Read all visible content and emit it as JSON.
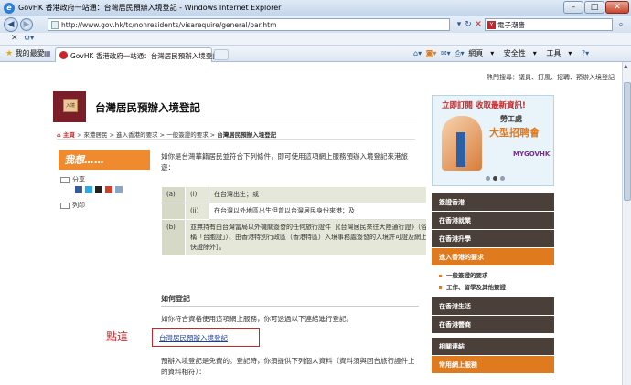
{
  "window": {
    "title": "GovHK 香港政府一站通：台灣居民預辦入境登記 - Windows Internet Explorer"
  },
  "browser": {
    "url": "http://www.gov.hk/tc/nonresidents/visarequire/general/par.htm",
    "search_value": "電子潮嗇",
    "favorites_label": "我的最愛",
    "tab_title": "GovHK 香港政府一站通：台灣居民預辦入境登記",
    "commands": [
      "網頁",
      "安全性",
      "工具"
    ]
  },
  "page": {
    "hotlinks": "熱門搜尋：議員、打風、招聘、預辦入境登記",
    "title": "台灣居民預辦入境登記",
    "stamp_label": "入境",
    "breadcrumb": {
      "home": "主頁",
      "items": [
        "來港居民",
        "進入香港的要求",
        "一般簽證的要求"
      ],
      "current": "台灣居民預辦入境登記"
    },
    "tools": {
      "title": "我想……",
      "share": "分享",
      "print": "列印"
    },
    "intro": "如你是台灣華籍居民並符合下列條件，即可使用這項網上服務預辦入境登記來港旅遊：",
    "conditions": [
      {
        "label": "(a)",
        "sub": "(i)",
        "text": "在台灣出生；或"
      },
      {
        "label": "",
        "sub": "(ii)",
        "text": "在台灣以外地區出生但曾以台灣居民身份來港；及"
      },
      {
        "label": "(b)",
        "sub": "",
        "text": "並無持有由台灣當局以外機關簽發的任何旅行證件［《台灣居民來往大陸通行證》（俗稱「台胞證」）、由香港特別行政區（香港特區）入境事務處簽發的入境許可證及網上快證除外］。"
      }
    ],
    "how_title": "如何登記",
    "how_text": "如你符合資格使用這項網上服務，你可透過以下連結進行登記。",
    "apply_link": "台灣居民預辦入境登記",
    "note": "點這",
    "free_text": "預辦入境登記是免費的。登記時，你須提供下列個人資料（資料須與回台旅行證件上的資料相符）："
  },
  "banner": {
    "line1": "立即訂閱 收取最新資訊!",
    "line2": "勞工處",
    "line3": "大型招聘會",
    "line4": "MYGOVHK"
  },
  "menu": {
    "items": [
      "簽證香港",
      "在香港就業",
      "在香港升學",
      "進入香港的要求"
    ],
    "sub": [
      "一般簽證的要求",
      "工作、留學及其他簽證"
    ],
    "items2": [
      "在香港生活",
      "在香港營商"
    ],
    "items3": [
      "相關連結",
      "常用網上服務"
    ]
  },
  "colors": {
    "accent": "#e07a1f",
    "brand_dark": "#7a1f2a",
    "annotation_red": "#c62828"
  }
}
